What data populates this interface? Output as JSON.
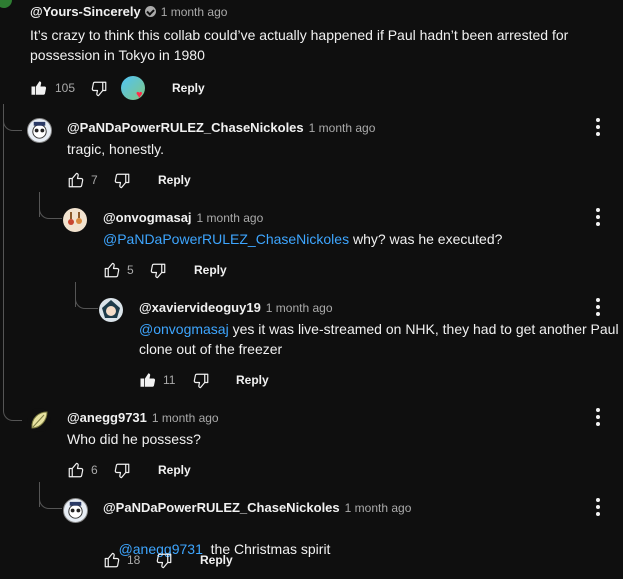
{
  "comments": [
    {
      "handle": "@Yours-Sincerely",
      "time": "1 month ago",
      "text": "It’s crazy to think this collab could’ve actually happened if Paul hadn’t been arrested for possession in Tokyo in 1980",
      "likes": "105",
      "reply_label": "Reply"
    },
    {
      "handle": "@PaNDaPowerRULEZ_ChaseNickoles",
      "time": "1 month ago",
      "text": "tragic, honestly.",
      "likes": "7",
      "reply_label": "Reply"
    },
    {
      "handle": "@onvogmasaj",
      "time": "1 month ago",
      "mention": "@PaNDaPowerRULEZ_ChaseNickoles",
      "text": " why? was he executed?",
      "likes": "5",
      "reply_label": "Reply"
    },
    {
      "handle": "@xaviervideoguy19",
      "time": "1 month ago",
      "mention": "@onvogmasaj",
      "text": " yes it was live-streamed on NHK, they had to get another Paul clone out of the freezer",
      "likes": "11",
      "reply_label": "Reply"
    },
    {
      "handle": "@anegg9731",
      "time": "1 month ago",
      "text": "Who did he possess?",
      "likes": "6",
      "reply_label": "Reply"
    },
    {
      "handle": "@PaNDaPowerRULEZ_ChaseNickoles",
      "time": "1 month ago",
      "mention": "@anegg9731",
      "text": "  the Christmas spirit",
      "likes": "18",
      "reply_label": "Reply"
    }
  ],
  "colors": {
    "background": "#0f0f0f",
    "mention": "#3ea6ff",
    "muted": "#aaaaaa",
    "heart": "#ff2b4a"
  },
  "icons": [
    "thumbs-up-icon",
    "thumbs-down-icon",
    "more-vert-icon",
    "verified-icon",
    "creator-heart-icon"
  ]
}
